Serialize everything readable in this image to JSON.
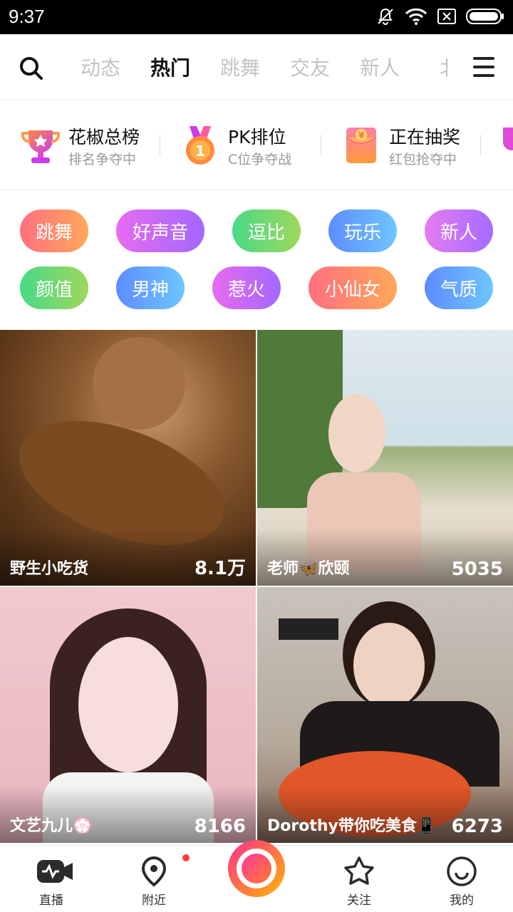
{
  "status_bar": {
    "time": "9:37"
  },
  "top_nav": {
    "tabs": [
      "动态",
      "热门",
      "跳舞",
      "交友",
      "新人",
      "北"
    ],
    "active_tab": "热门"
  },
  "features": [
    {
      "title": "花椒总榜",
      "subtitle": "排名争夺中",
      "icon": "trophy-icon"
    },
    {
      "title": "PK排位",
      "subtitle": "C位争夺战",
      "icon": "medal-icon"
    },
    {
      "title": "正在抽奖",
      "subtitle": "红包抢夺中",
      "icon": "red-envelope-icon"
    }
  ],
  "tags": [
    {
      "label": "跳舞",
      "color_from": "#ff6f7f",
      "color_to": "#ffa85a"
    },
    {
      "label": "好声音",
      "color_from": "#e76bf0",
      "color_to": "#a368ff"
    },
    {
      "label": "逗比",
      "color_from": "#48d987",
      "color_to": "#9fd85c"
    },
    {
      "label": "玩乐",
      "color_from": "#5e8cff",
      "color_to": "#6ec6ff"
    },
    {
      "label": "新人",
      "color_from": "#e47bf1",
      "color_to": "#a56cff"
    },
    {
      "label": "颜值",
      "color_from": "#48d987",
      "color_to": "#9fd85c"
    },
    {
      "label": "男神",
      "color_from": "#5e8cff",
      "color_to": "#6ec6ff"
    },
    {
      "label": "惹火",
      "color_from": "#e76bf0",
      "color_to": "#a368ff"
    },
    {
      "label": "小仙女",
      "color_from": "#ff6f7f",
      "color_to": "#ffa85a"
    },
    {
      "label": "气质",
      "color_from": "#5e8cff",
      "color_to": "#6ec6ff"
    }
  ],
  "live_cards": [
    {
      "name": "野生小吃货",
      "viewers": "8.1万"
    },
    {
      "name": "老师🦋欣颐",
      "viewers": "5035"
    },
    {
      "name": "文艺九儿💮",
      "viewers": "8166"
    },
    {
      "name": "Dorothy带你吃美食📱",
      "viewers": "6273"
    }
  ],
  "bottom_nav": {
    "items": [
      "直播",
      "附近",
      "关注",
      "我的"
    ]
  }
}
